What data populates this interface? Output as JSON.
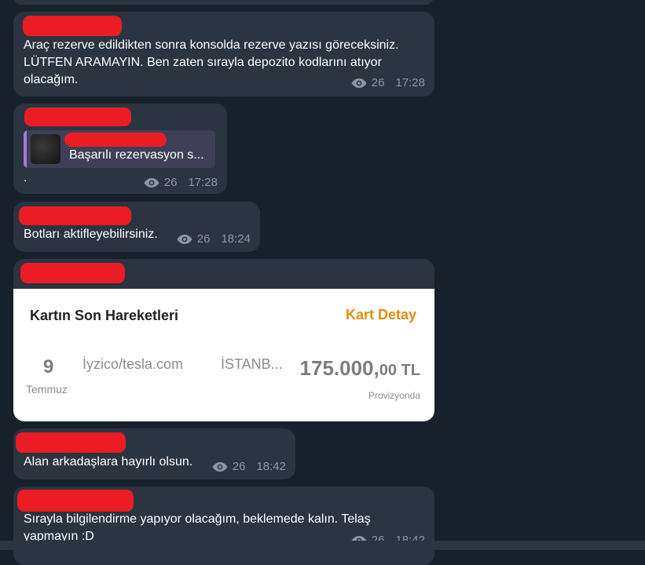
{
  "messages": [
    {
      "text": "Araç rezerve edildikten sonra konsolda rezerve yazısı göreceksiniz.\nLÜTFEN ARAMAYIN. Ben zaten sırayla depozito kodlarını atıyor\nolacağım.",
      "views": "26",
      "time": "17:28"
    },
    {
      "reply_text": "Başarılı rezervasyon s...",
      "text": ".",
      "views": "26",
      "time": "17:28"
    },
    {
      "text": "Botları aktifleyebilirsiniz.",
      "views": "26",
      "time": "18:24"
    },
    {
      "card": {
        "title": "Kartın Son Hareketleri",
        "detail_link": "Kart Detay",
        "day": "9",
        "month": "Temmuz",
        "merchant": "İyzico/tesla.com",
        "city": "İSTANB...",
        "amount_main": "175.000,",
        "amount_decimal": "00 TL",
        "status": "Provizyonda"
      }
    },
    {
      "text": "Alan arkadaşlara hayırlı olsun.",
      "views": "26",
      "time": "18:42"
    },
    {
      "text": "Sırayla bilgilendirme yapıyor olacağım, beklemede kalın. Telaş\nyapmayın :D",
      "views": "26",
      "time": "18:42"
    }
  ],
  "colors": {
    "background": "#17212b",
    "bubble": "#2b3441",
    "redaction": "#ec1c24",
    "accent_orange": "#dd8e12",
    "reply_bar": "#a57ad8"
  }
}
